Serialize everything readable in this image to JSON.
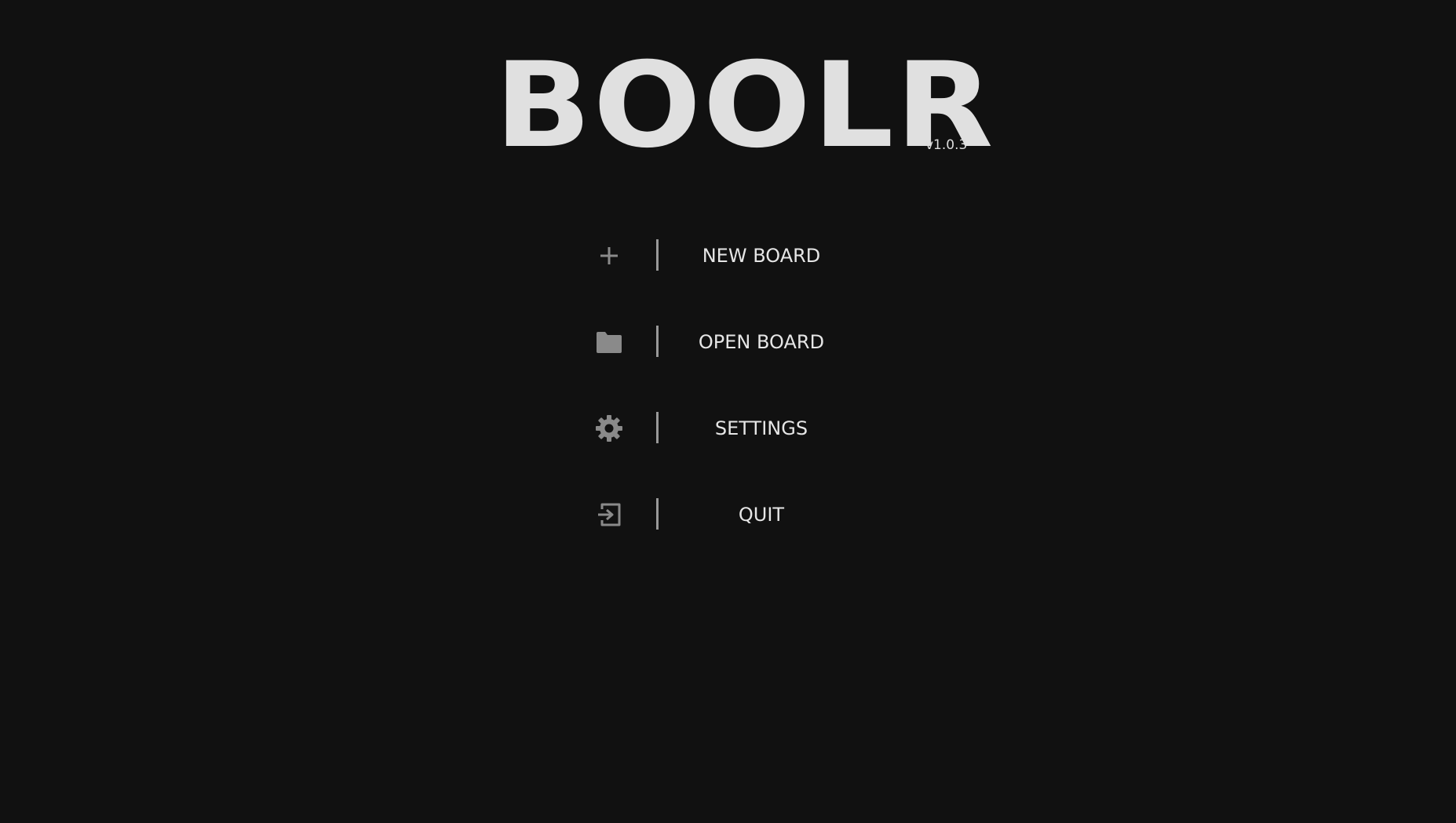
{
  "app": {
    "title": "BOOLR",
    "version": "v1.0.3"
  },
  "menu": {
    "items": [
      {
        "label": "NEW BOARD",
        "icon": "plus-icon"
      },
      {
        "label": "OPEN BOARD",
        "icon": "folder-icon"
      },
      {
        "label": "SETTINGS",
        "icon": "gear-icon"
      },
      {
        "label": "QUIT",
        "icon": "exit-icon"
      }
    ]
  },
  "colors": {
    "background": "#111111",
    "text": "#e0e0e0",
    "icon": "#8a8a8a",
    "divider": "#999999"
  }
}
